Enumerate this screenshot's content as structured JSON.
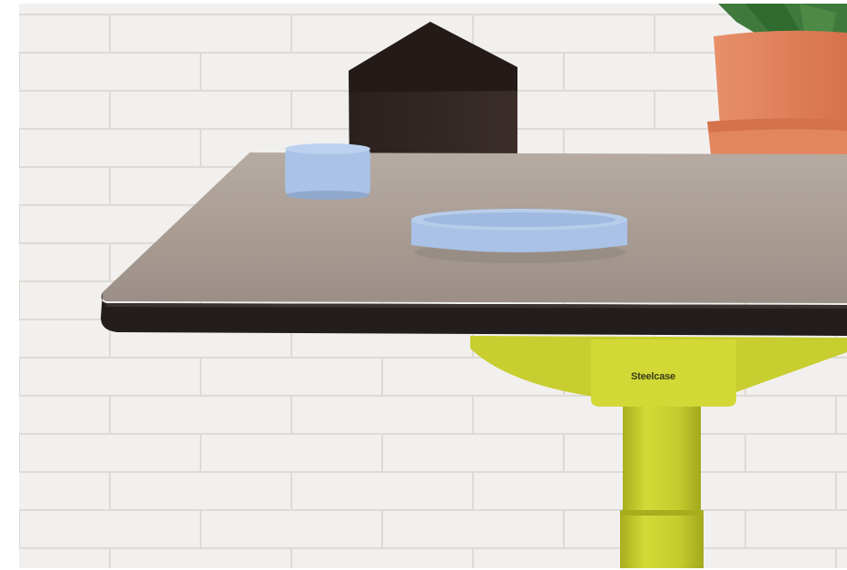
{
  "photo": {
    "brand_text": "Steelcase",
    "colors": {
      "wall": "#f1f0ee",
      "brick_line": "#dddbd7",
      "tabletop": "#a99d94",
      "table_edge": "#231e1d",
      "leg_yellow": "#c6cc2e",
      "house": "#2c211e",
      "cup_blue": "#a9c2e6",
      "pot_terracotta": "#e3805a",
      "plant_green": "#3f7a3c"
    },
    "objects": [
      "brick-wall",
      "desk-top",
      "desk-leg",
      "house-box",
      "small-blue-cup",
      "blue-dish",
      "terracotta-pot",
      "plant"
    ]
  }
}
